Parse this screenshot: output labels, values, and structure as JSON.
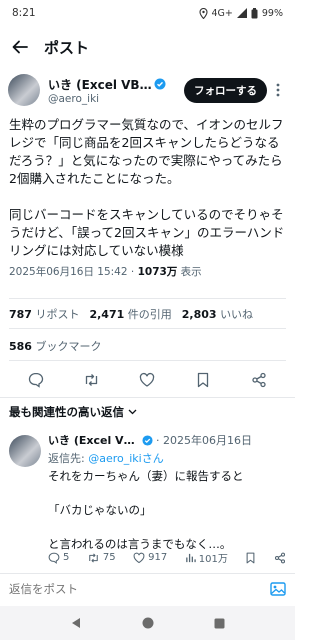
{
  "status": {
    "time": "8:21",
    "network": "4G+",
    "battery": "99%"
  },
  "header": {
    "title": "ポスト"
  },
  "tweet": {
    "author_name": "いき (Excel VBA超効...",
    "author_handle": "@aero_iki",
    "follow_label": "フォローする",
    "text": "生粋のプログラマー気質なので、イオンのセルフレジで「同じ商品を2回スキャンしたらどうなるだろう？」と気になったので実際にやってみたら2個購入されたことになった。\n\n同じバーコードをスキャンしているのでそりゃそうだけど、「誤って2回スキャン」のエラーハンドリングには対応していない模様",
    "datetime": "2025年06月16日 15:42",
    "sep": "·",
    "views_count": "1073万",
    "views_label": "表示"
  },
  "stats": {
    "reposts_count": "787",
    "reposts_label": "リポスト",
    "quotes_count": "2,471",
    "quotes_label": "件の引用",
    "likes_count": "2,803",
    "likes_label": "いいね",
    "bookmarks_count": "586",
    "bookmarks_label": "ブックマーク"
  },
  "sort_label": "最も関連性の高い返信",
  "reply": {
    "author_name": "いき (Excel VBA超...",
    "date": "· 2025年06月16日",
    "reply_to_prefix": "返信先:",
    "reply_to_handle": "@aero_ikiさん",
    "text": "それをカーちゃん（妻）に報告すると\n\n「バカじゃないの」\n\nと言われるのは言うまでもなく…。",
    "replies": "5",
    "reposts": "75",
    "likes": "917",
    "views": "101万"
  },
  "compose": {
    "placeholder": "返信をポスト"
  },
  "colors": {
    "accent": "#1d9bf0",
    "text": "#0f1419",
    "muted": "#536471"
  }
}
